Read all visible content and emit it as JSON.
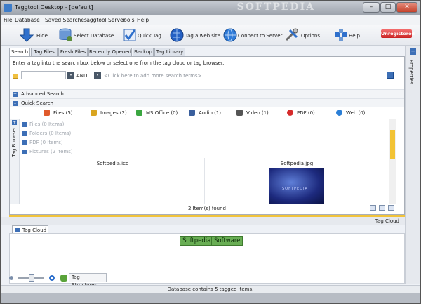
{
  "window": {
    "title": "Taggtool Desktop - [default]",
    "watermark": "SOFTPEDIA"
  },
  "menu": [
    "File",
    "Database",
    "Saved Searches",
    "Taggtool Server",
    "Tools",
    "Help"
  ],
  "toolbar": {
    "hide": "Hide",
    "select_db": "Select Database",
    "quick_tag": "Quick Tag",
    "tag_website": "Tag a web site",
    "connect": "Connect to Server",
    "options": "Options",
    "help": "Help",
    "unregistered": "Unregistered"
  },
  "tabs": [
    "Search",
    "Tag Files",
    "Fresh Files",
    "Recently Opened",
    "Backup",
    "Tag Library"
  ],
  "side_panel": {
    "properties": "Properties"
  },
  "search": {
    "hint": "Enter a tag into the search box below or select one from the tag cloud or tag browser.",
    "operator": "AND",
    "add_terms": "<Click here to add more search terms>"
  },
  "advanced_search": "Advanced Search",
  "quick_search": {
    "title": "Quick Search",
    "items": [
      {
        "label": "Files (5)",
        "color": "#e05a2b"
      },
      {
        "label": "Images (2)",
        "color": "#d9a520"
      },
      {
        "label": "MS Office (0)",
        "color": "#3aa640"
      },
      {
        "label": "Audio (1)",
        "color": "#3a5f9d"
      },
      {
        "label": "Video (1)",
        "color": "#555555"
      },
      {
        "label": "PDF (0)",
        "color": "#d62b2b"
      },
      {
        "label": "Web (0)",
        "color": "#2b7fd6"
      }
    ]
  },
  "tag_browser": {
    "label": "Tag Browser",
    "groups": [
      "Files (0 Items)",
      "Folders (0 Items)",
      "PDF (0 Items)",
      "Pictures (2 Items)"
    ],
    "thumbs": [
      {
        "name": "Softpedia.ico"
      },
      {
        "name": "Softpedia.jpg",
        "image_text": "SOFTPEDIA"
      }
    ],
    "found": "2 Item(s) found"
  },
  "tag_cloud": {
    "header": "Tag Cloud",
    "tab": "Tag Cloud",
    "tags": [
      "Softpedia",
      "Software"
    ],
    "structures": "Tag Structures"
  },
  "status": "Database contains 5 tagged items."
}
